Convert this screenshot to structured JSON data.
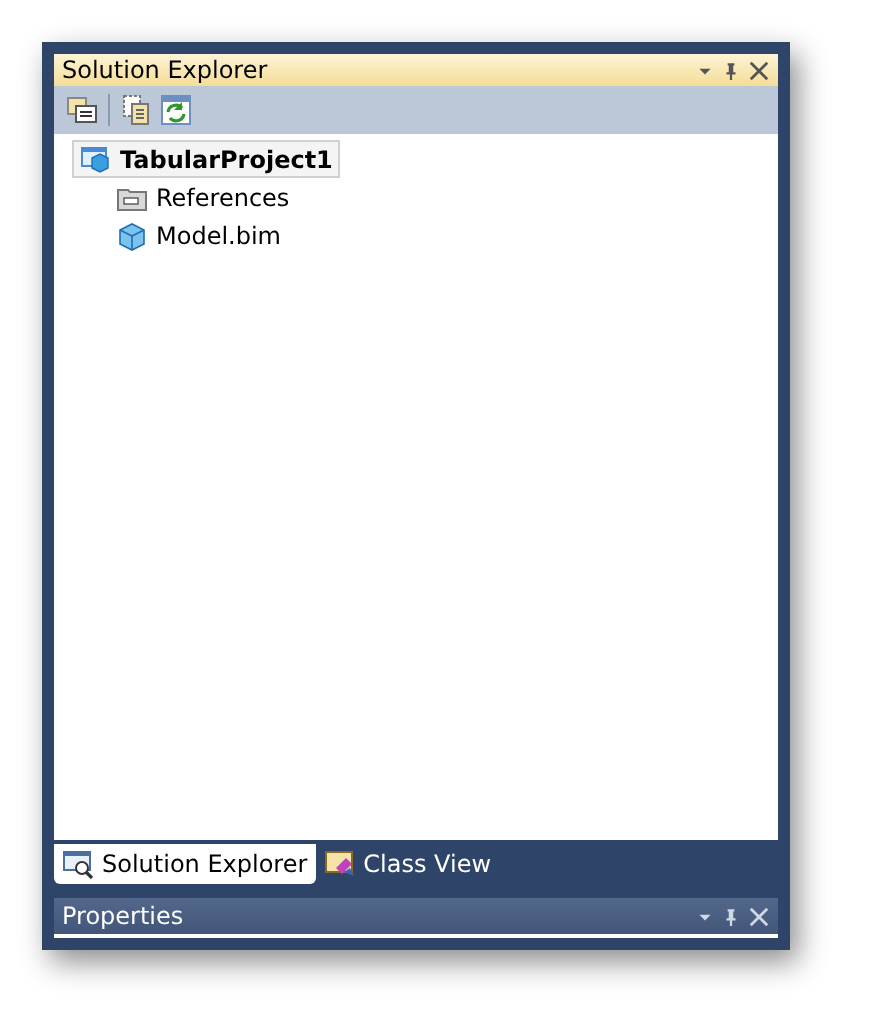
{
  "solution_explorer": {
    "title": "Solution Explorer",
    "toolbar": [
      {
        "kind": "properties"
      },
      {
        "kind": "show-all"
      },
      {
        "kind": "refresh"
      }
    ],
    "tree": [
      {
        "label": "TabularProject1",
        "kind": "project",
        "selected": true,
        "children": [
          {
            "label": "References",
            "kind": "references",
            "selected": false
          },
          {
            "label": "Model.bim",
            "kind": "model",
            "selected": false
          }
        ]
      }
    ]
  },
  "tabs": [
    {
      "label": "Solution Explorer",
      "kind": "solution",
      "selected": true
    },
    {
      "label": "Class View",
      "kind": "class",
      "selected": false
    }
  ],
  "properties": {
    "title": "Properties"
  }
}
